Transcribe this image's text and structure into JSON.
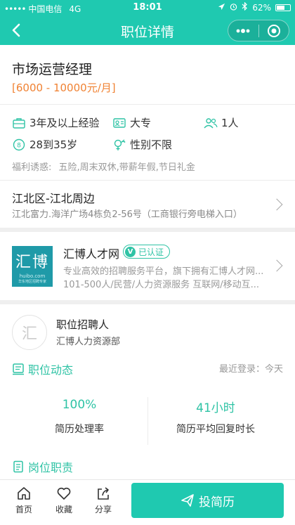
{
  "status_bar": {
    "carrier": "中国电信",
    "network": "4G",
    "time": "18:01",
    "battery": "62%",
    "battery_level": 0.62
  },
  "header": {
    "title": "职位详情"
  },
  "job": {
    "title": "市场运营经理",
    "salary": "[6000 - 10000元/月]",
    "experience": "3年及以上经验",
    "education": "大专",
    "headcount": "1人",
    "age": "28到35岁",
    "gender": "性别不限",
    "welfare_label": "福利诱惑:",
    "welfare_items": "五险,周末双休,带薪年假,节日礼金",
    "address_title": "江北区-江北周边",
    "address_detail": "江北富力.海洋广场4栋负2-56号（工商银行旁电梯入口）"
  },
  "company": {
    "logo_text": "汇博",
    "logo_domain": "huibo.com",
    "logo_slogan": "华东地区招聘专家",
    "name": "汇博人才网",
    "verified_label": "已认证",
    "description": "专业高效的招聘服务平台，旗下拥有汇博人才网...",
    "meta": "101-500人/民营/人力资源服务 互联网/移动互..."
  },
  "recruiter": {
    "avatar_text": "汇",
    "role": "职位招聘人",
    "company": "汇博人力资源部"
  },
  "dynamics": {
    "title": "职位动态",
    "last_login": "最近登录：今天",
    "process_rate_value": "100%",
    "process_rate_label": "简历处理率",
    "reply_time_value": "41小时",
    "reply_time_label": "简历平均回复时长"
  },
  "duties": {
    "title": "岗位职责"
  },
  "tabbar": {
    "home": "首页",
    "favorite": "收藏",
    "share": "分享",
    "apply": "投简历"
  },
  "colors": {
    "brand": "#1fc9b0",
    "accent_green": "#2fc3a5",
    "salary": "#f08233"
  }
}
